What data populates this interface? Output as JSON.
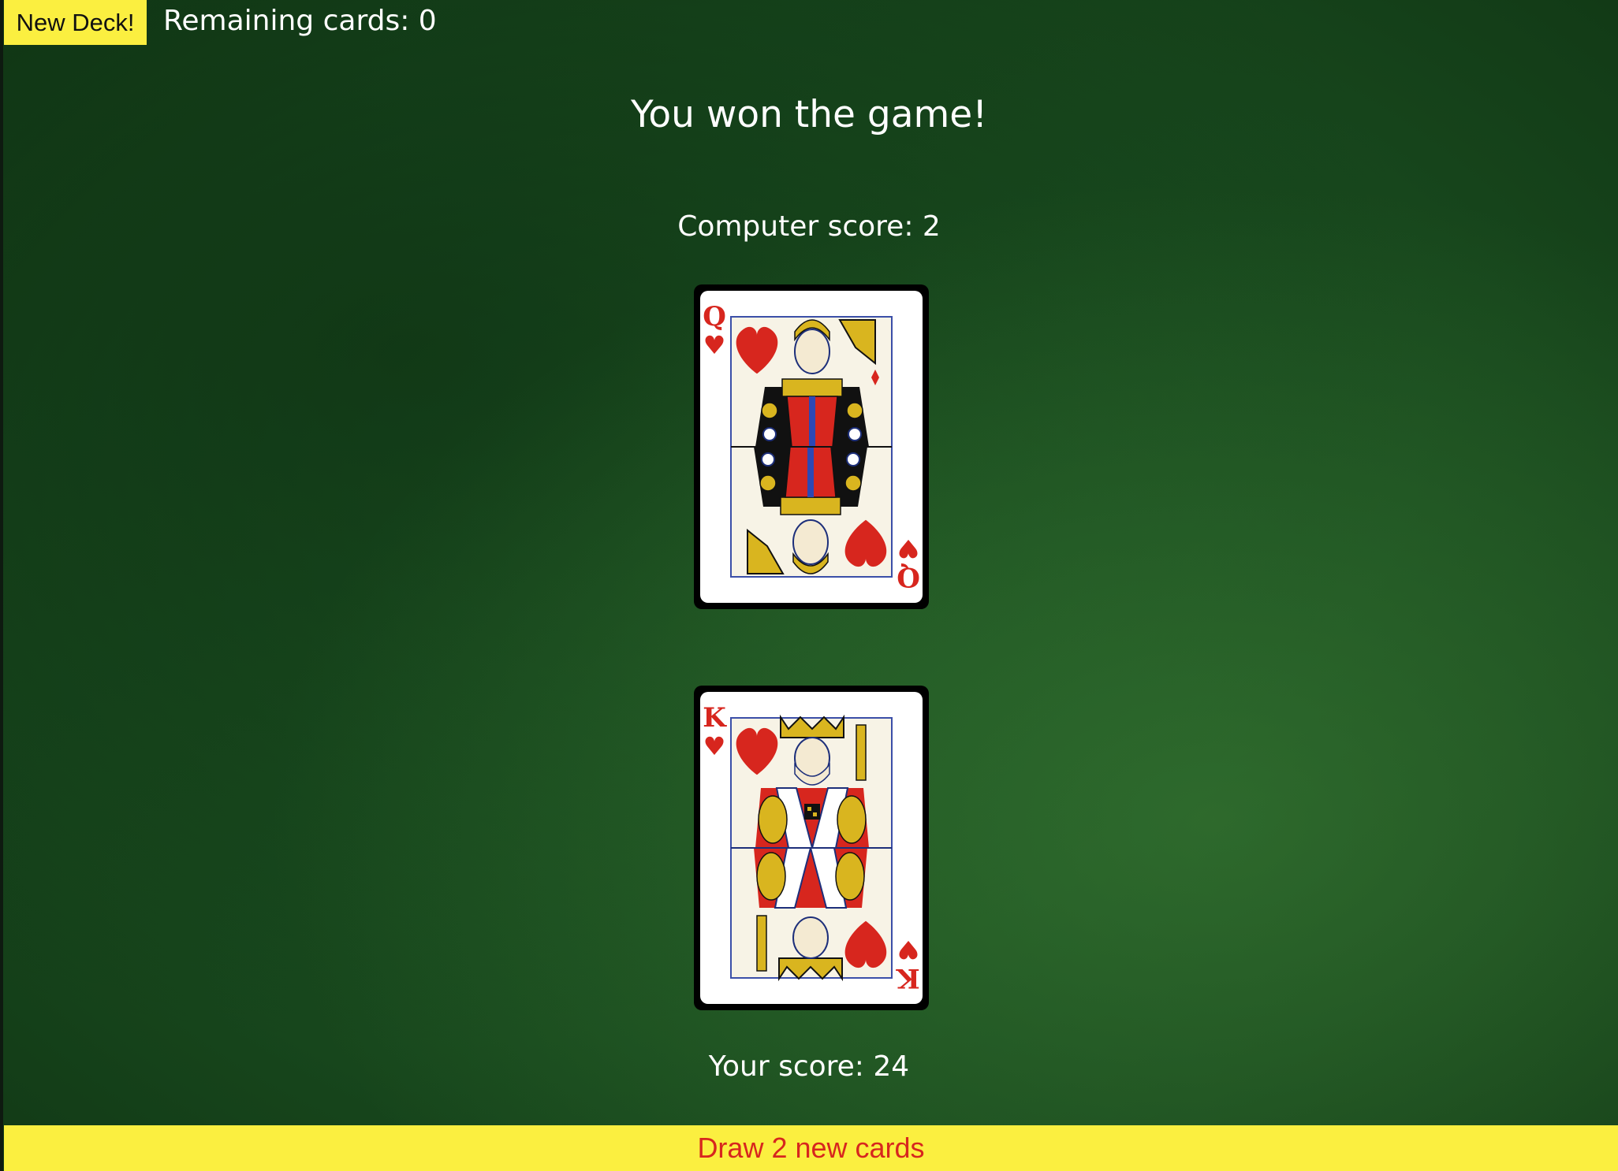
{
  "header": {
    "new_deck_label": "New Deck!",
    "remaining_label": "Remaining cards: 0"
  },
  "game": {
    "result": "You won the game!",
    "computer_score": "Computer score: 2",
    "your_score": "Your score: 24"
  },
  "cards": {
    "computer": {
      "rank": "Q",
      "suit": "♥",
      "name": "queen-of-hearts"
    },
    "player": {
      "rank": "K",
      "suit": "♥",
      "name": "king-of-hearts"
    }
  },
  "actions": {
    "draw_label": "Draw 2 new cards"
  },
  "colors": {
    "button_yellow": "#fbef40",
    "draw_text_red": "#d7261e",
    "felt_green": "#1f5a25",
    "card_red": "#d7261e"
  }
}
